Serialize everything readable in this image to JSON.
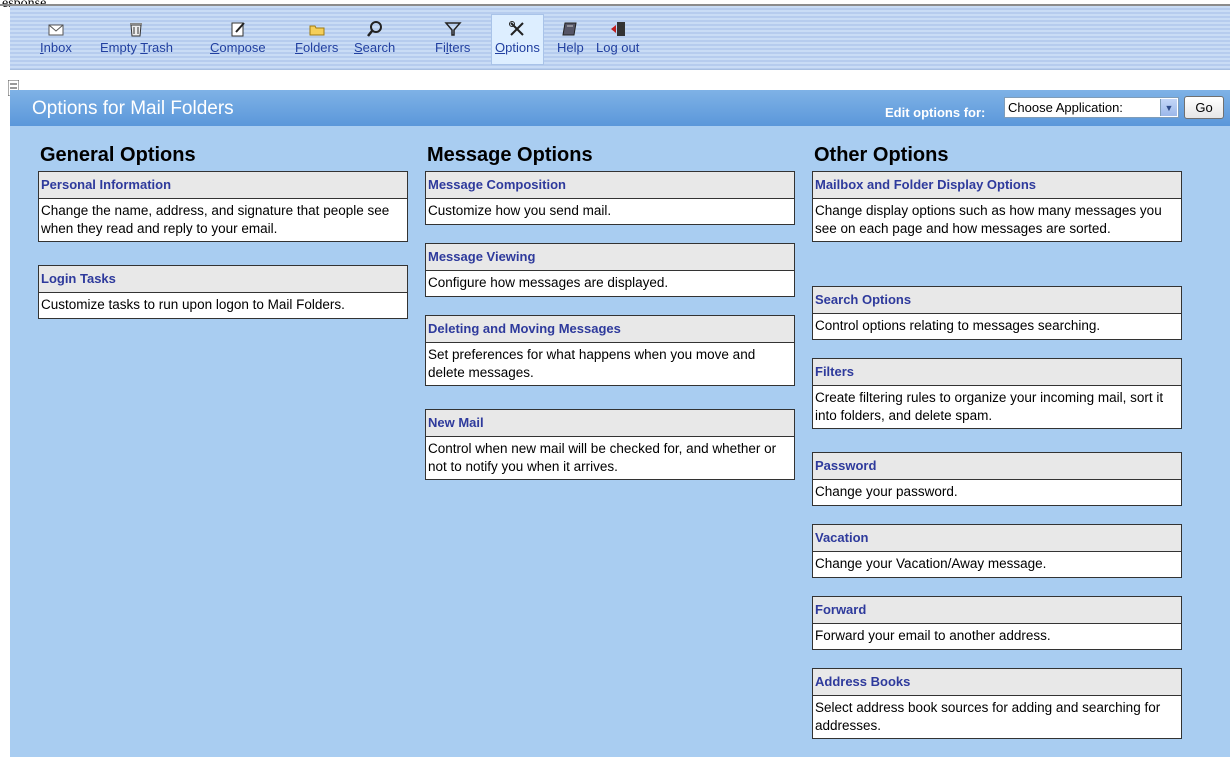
{
  "window_caption": "esponse",
  "toolbar": [
    {
      "name": "inbox",
      "icon": "envelope-icon",
      "pre": "",
      "u": "I",
      "post": "nbox"
    },
    {
      "name": "empty-trash",
      "icon": "trash-icon",
      "pre": "Empty ",
      "u": "T",
      "post": "rash"
    },
    {
      "name": "compose",
      "icon": "compose-icon",
      "pre": "",
      "u": "C",
      "post": "ompose"
    },
    {
      "name": "folders",
      "icon": "folder-icon",
      "pre": "",
      "u": "F",
      "post": "olders"
    },
    {
      "name": "search",
      "icon": "search-icon",
      "pre": "",
      "u": "S",
      "post": "earch"
    },
    {
      "name": "filters",
      "icon": "filter-icon",
      "pre": "Fi",
      "u": "l",
      "post": "ters"
    },
    {
      "name": "options",
      "icon": "tools-icon",
      "pre": "",
      "u": "O",
      "post": "ptions"
    },
    {
      "name": "help",
      "icon": "help-book-icon",
      "pre": "Help",
      "u": "",
      "post": ""
    },
    {
      "name": "log-out",
      "icon": "logout-door-icon",
      "pre": "Log out",
      "u": "",
      "post": ""
    }
  ],
  "page_title": "Options for Mail Folders",
  "edit_options_label": "Edit options for:",
  "app_select_value": "Choose Application:",
  "go_label": "Go",
  "columns": {
    "general": {
      "heading": "General Options",
      "items": [
        {
          "title": "Personal Information",
          "desc": "Change the name, address, and signature that people see when they read and reply to your email."
        },
        {
          "title": "Login Tasks",
          "desc": "Customize tasks to run upon logon to Mail Folders."
        }
      ]
    },
    "message": {
      "heading": "Message Options",
      "items": [
        {
          "title": "Message Composition",
          "desc": "Customize how you send mail."
        },
        {
          "title": "Message Viewing",
          "desc": "Configure how messages are displayed."
        },
        {
          "title": "Deleting and Moving Messages",
          "desc": "Set preferences for what happens when you move and delete messages."
        },
        {
          "title": "New Mail",
          "desc": "Control when new mail will be checked for, and whether or not to notify you when it arrives."
        }
      ]
    },
    "other": {
      "heading": "Other Options",
      "items": [
        {
          "title": "Mailbox and Folder Display Options",
          "desc": "Change display options such as how many messages you see on each page and how messages are sorted."
        },
        {
          "title": "Search Options",
          "desc": "Control options relating to messages searching."
        },
        {
          "title": "Filters",
          "desc": "Create filtering rules to organize your incoming mail, sort it into folders, and delete spam."
        },
        {
          "title": "Password",
          "desc": "Change your password."
        },
        {
          "title": "Vacation",
          "desc": "Change your Vacation/Away message."
        },
        {
          "title": "Forward",
          "desc": "Forward your email to another address."
        },
        {
          "title": "Address Books",
          "desc": "Select address book sources for adding and searching for addresses."
        }
      ]
    }
  }
}
